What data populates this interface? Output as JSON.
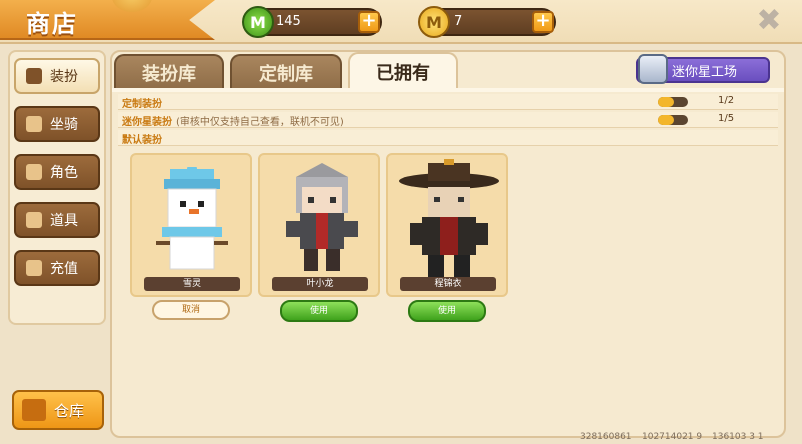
{
  "header": {
    "title": "商店",
    "gem_count": "145",
    "coin_count": "7",
    "plus_label": "+",
    "close_label": "✖"
  },
  "sidebar": {
    "items": [
      {
        "label": "装扮",
        "icon": "shirt-icon",
        "active": true
      },
      {
        "label": "坐骑",
        "icon": "mount-icon",
        "active": false
      },
      {
        "label": "角色",
        "icon": "character-icon",
        "active": false
      },
      {
        "label": "道具",
        "icon": "item-icon",
        "active": false
      },
      {
        "label": "充值",
        "icon": "coins-icon",
        "active": false
      }
    ],
    "warehouse_label": "仓库"
  },
  "tabs": [
    {
      "label": "装扮库",
      "active": false
    },
    {
      "label": "定制库",
      "active": false
    },
    {
      "label": "已拥有",
      "active": true
    }
  ],
  "workshop_label": "迷你星工场",
  "sections": [
    {
      "label": "定制装扮",
      "note": "",
      "count": "1/2",
      "has_toggle": true
    },
    {
      "label": "迷你星装扮",
      "note": "(审核中仅支持自己查看，联机不可见)",
      "count": "1/5",
      "has_toggle": true
    },
    {
      "label": "默认装扮",
      "note": "",
      "count": "",
      "has_toggle": false
    }
  ],
  "skins": [
    {
      "name": "雪灵",
      "button": "取消",
      "button_style": "cancel"
    },
    {
      "name": "叶小龙",
      "button": "使用",
      "button_style": "use"
    },
    {
      "name": "程锦衣",
      "button": "使用",
      "button_style": "use"
    }
  ],
  "footer": [
    "328160861",
    "102714021 9",
    "136103 3 1"
  ],
  "colors": {
    "accent_orange": "#e08a24",
    "use_green": "#3fa21c",
    "workshop_purple": "#6a4fbf",
    "wood_brown": "#7f5229"
  }
}
